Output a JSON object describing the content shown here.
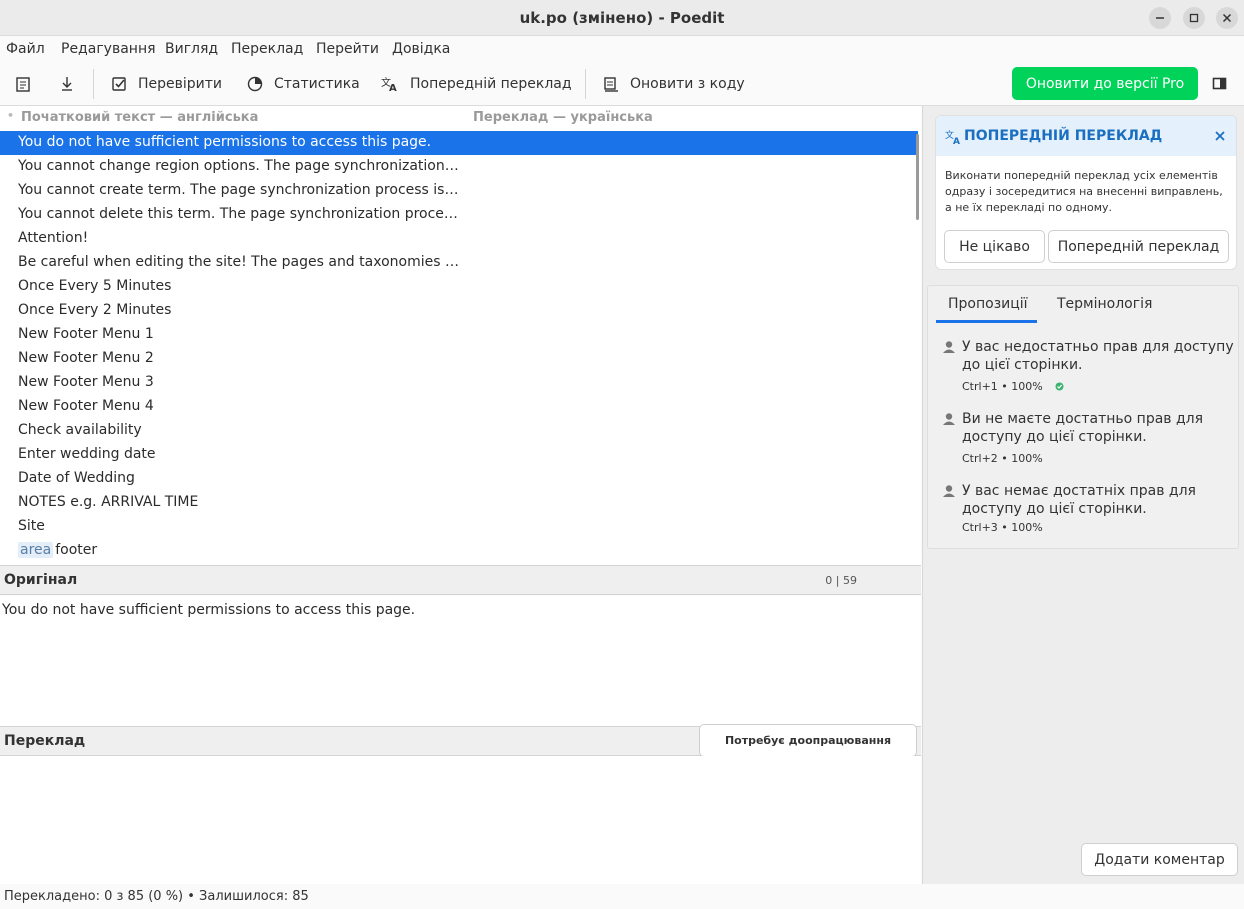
{
  "window": {
    "title": "uk.po (змінено) - Poedit"
  },
  "menu": [
    "Файл",
    "Редагування",
    "Вигляд",
    "Переклад",
    "Перейти",
    "Довідка"
  ],
  "toolbar": {
    "validate": "Перевірити",
    "statistics": "Статистика",
    "pretranslate": "Попередній переклад",
    "update_from_code": "Оновити з коду",
    "upgrade_pro": "Оновити до версії Pro"
  },
  "list": {
    "col_source": "Початковий текст — англійська",
    "col_translation": "Переклад — українська",
    "rows": [
      {
        "source": "You do not have sufficient permissions to access this page.",
        "context": ""
      },
      {
        "source": "You cannot change region options. The page synchronization process is in progress.",
        "context": ""
      },
      {
        "source": "You cannot create term. The page synchronization process is in progress.",
        "context": ""
      },
      {
        "source": "You cannot delete this term. The page synchronization process is in progress.",
        "context": ""
      },
      {
        "source": "Attention!",
        "context": ""
      },
      {
        "source": "Be careful when editing the site! The pages and taxonomies are connected.",
        "context": ""
      },
      {
        "source": "Once Every 5 Minutes",
        "context": ""
      },
      {
        "source": "Once Every 2 Minutes",
        "context": ""
      },
      {
        "source": "New Footer Menu 1",
        "context": ""
      },
      {
        "source": "New Footer Menu 2",
        "context": ""
      },
      {
        "source": "New Footer Menu 3",
        "context": ""
      },
      {
        "source": "New Footer Menu 4",
        "context": ""
      },
      {
        "source": "Check availability",
        "context": ""
      },
      {
        "source": "Enter wedding date",
        "context": ""
      },
      {
        "source": "Date of Wedding",
        "context": ""
      },
      {
        "source": "NOTES e.g. ARRIVAL TIME",
        "context": ""
      },
      {
        "source": "Site",
        "context": ""
      },
      {
        "source": "footer",
        "context": "area"
      }
    ]
  },
  "original": {
    "label": "Оригінал",
    "counter": "0 | 59",
    "text": "You do not have sufficient permissions to access this page."
  },
  "translation": {
    "label": "Переклад",
    "fuzzy_button": "Потребує доопрацювання"
  },
  "status": "Перекладено: 0 з 85 (0 %)  •  Залишилося: 85",
  "pretranslate_panel": {
    "title": "ПОПЕРЕДНІЙ ПЕРЕКЛАД",
    "description": "Виконати попередній переклад усіх елементів одразу і зосередитися на внесенні виправлень, а не їх перекладі по одному.",
    "not_interested": "Не цікаво",
    "action": "Попередній переклад"
  },
  "suggestions": {
    "tab_suggestions": "Пропозиції",
    "tab_terminology": "Термінологія",
    "items": [
      {
        "text": "У вас недостатньо прав для доступу до цієї сторінки.",
        "meta": "Ctrl+1 • 100%"
      },
      {
        "text": "Ви не маєте достатньо прав для доступу до цієї сторінки.",
        "meta": "Ctrl+2 • 100%"
      },
      {
        "text": "У вас немає достатніх прав для доступу до цієї сторінки.",
        "meta": "Ctrl+3 • 100%"
      }
    ]
  },
  "add_comment": "Додати коментар",
  "colors": {
    "accent": "#1a73e8",
    "pro_green": "#00d25a",
    "panel_title": "#1a6fc1"
  }
}
